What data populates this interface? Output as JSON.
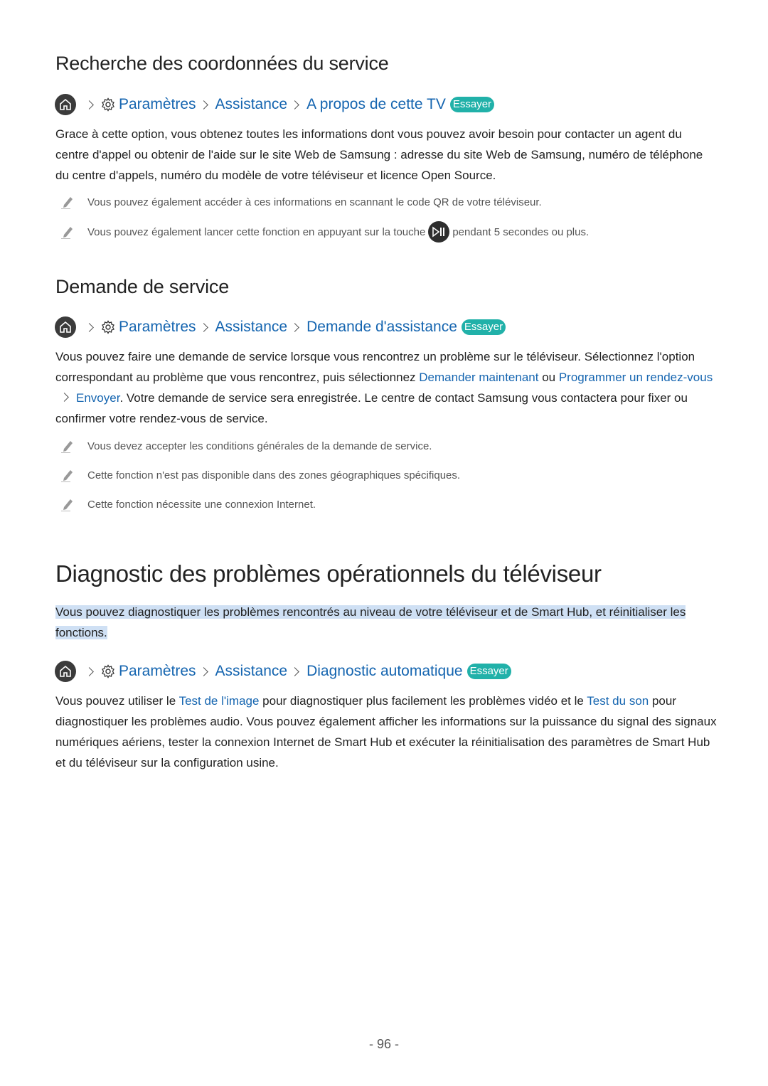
{
  "sections": {
    "contact": {
      "title": "Recherche des coordonnées du service",
      "breadcrumb": [
        "Paramètres",
        "Assistance",
        "A propos de cette TV"
      ],
      "try_label": "Essayer",
      "body": "Grace à cette option, vous obtenez toutes les informations dont vous pouvez avoir besoin pour contacter un agent du centre d'appel ou obtenir de l'aide sur le site Web de Samsung : adresse du site Web de Samsung, numéro de téléphone du centre d'appels, numéro du modèle de votre téléviseur et licence Open Source.",
      "notes": [
        "Vous pouvez également accéder à ces informations en scannant le code QR de votre téléviseur.",
        {
          "before": "Vous pouvez également lancer cette fonction en appuyant sur la touche",
          "icon": "play-pause-icon",
          "after": "pendant 5 secondes ou plus."
        }
      ]
    },
    "request": {
      "title": "Demande de service",
      "breadcrumb": [
        "Paramètres",
        "Assistance",
        "Demande d'assistance"
      ],
      "try_label": "Essayer",
      "body_parts": {
        "p1": "Vous pouvez faire une demande de service lorsque vous rencontrez un problème sur le téléviseur. Sélectionnez l'option correspondant au problème que vous rencontrez, puis sélectionnez ",
        "link1": "Demander maintenant",
        "p2": " ou ",
        "link2": "Programmer un rendez-vous",
        "link3": "Envoyer",
        "p3": ". Votre demande de service sera enregistrée. Le centre de contact Samsung vous contactera pour fixer ou confirmer votre rendez-vous de service."
      },
      "notes": [
        "Vous devez accepter les conditions générales de la demande de service.",
        "Cette fonction n'est pas disponible dans des zones géographiques spécifiques.",
        "Cette fonction nécessite une connexion Internet."
      ]
    },
    "diagnostic": {
      "title": "Diagnostic des problèmes opérationnels du téléviseur",
      "intro": "Vous pouvez diagnostiquer les problèmes rencontrés au niveau de votre téléviseur et de Smart Hub, et réinitialiser les fonctions.",
      "breadcrumb": [
        "Paramètres",
        "Assistance",
        "Diagnostic automatique"
      ],
      "try_label": "Essayer",
      "body_parts": {
        "p1": "Vous pouvez utiliser le ",
        "link1": "Test de l'image",
        "p2": " pour diagnostiquer plus facilement les problèmes vidéo et le ",
        "link2": "Test du son",
        "p3": " pour diagnostiquer les problèmes audio. Vous pouvez également afficher les informations sur la puissance du signal des signaux numériques aériens, tester la connexion Internet de Smart Hub et exécuter la réinitialisation des paramètres de Smart Hub et du téléviseur sur la configuration usine."
      }
    }
  },
  "page_number": "- 96 -",
  "colors": {
    "link": "#1565b0",
    "try_badge": "#21b1a9",
    "highlight": "#cfe0f4"
  }
}
